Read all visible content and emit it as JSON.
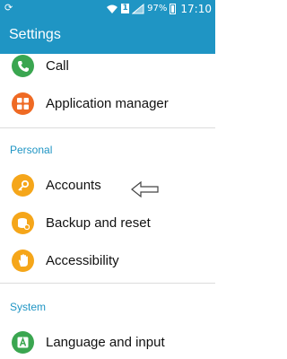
{
  "status_bar": {
    "left_icon": "sync-icon",
    "sim_badge": "1",
    "battery_percent": "97%",
    "time": "17:10"
  },
  "app_bar": {
    "title": "Settings"
  },
  "items": {
    "call": {
      "label": "Call",
      "icon": "phone-icon",
      "color": "#3aa650"
    },
    "app_manager": {
      "label": "Application manager",
      "icon": "grid-icon",
      "color": "#ef6a24"
    },
    "accounts": {
      "label": "Accounts",
      "icon": "key-icon",
      "color": "#f5a61a"
    },
    "backup": {
      "label": "Backup and reset",
      "icon": "backup-icon",
      "color": "#f5a61a"
    },
    "accessibility": {
      "label": "Accessibility",
      "icon": "hand-icon",
      "color": "#f5a61a"
    },
    "language": {
      "label": "Language and input",
      "icon": "language-icon",
      "color": "#3aa650"
    }
  },
  "sections": {
    "personal": "Personal",
    "system": "System"
  },
  "colors": {
    "accent": "#1f95c4"
  }
}
